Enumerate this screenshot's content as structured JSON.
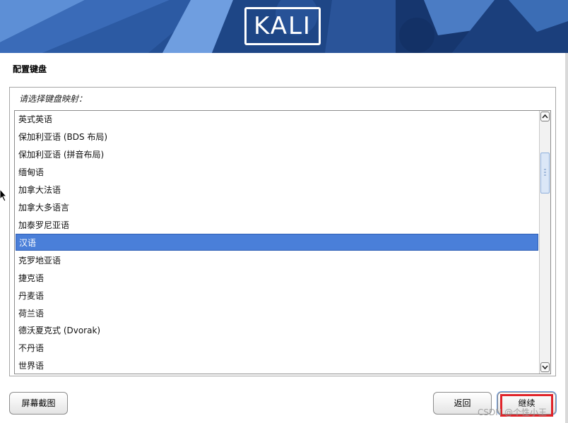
{
  "banner": {
    "logo_text": "KALI"
  },
  "page": {
    "title": "配置键盘",
    "prompt": "请选择键盘映射：",
    "keymaps": [
      "英式英语",
      "保加利亚语 (BDS 布局)",
      "保加利亚语 (拼音布局)",
      "缅甸语",
      "加拿大法语",
      "加拿大多语言",
      "加泰罗尼亚语",
      "汉语",
      "克罗地亚语",
      "捷克语",
      "丹麦语",
      "荷兰语",
      "德沃夏克式 (Dvorak)",
      "不丹语",
      "世界语"
    ],
    "selected_keymap": "汉语"
  },
  "buttons": {
    "screenshot": "屏幕截图",
    "back": "返回",
    "continue": "继续"
  },
  "watermark": "CSDN @个性小王"
}
